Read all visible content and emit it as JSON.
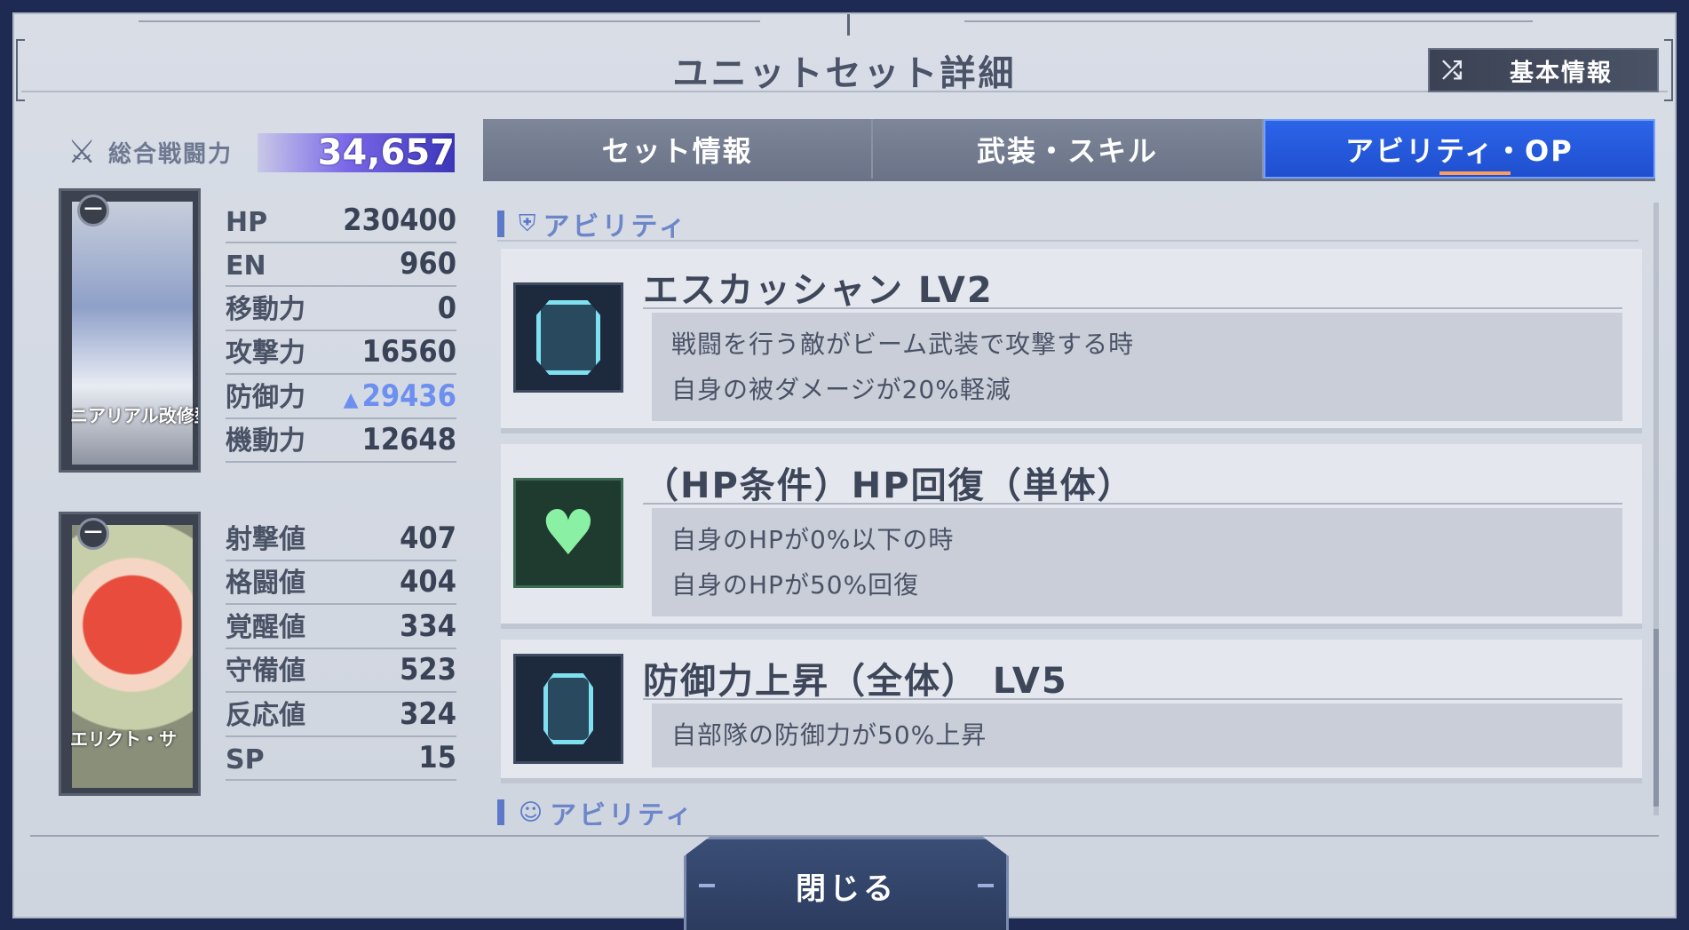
{
  "header": {
    "title": "ユニットセット詳細",
    "info_button_label": "基本情報"
  },
  "power": {
    "label": "総合戦闘力",
    "value": "34,657"
  },
  "unit": {
    "name": "ニアリアル改修型",
    "stats": [
      {
        "label": "HP",
        "value": "230400"
      },
      {
        "label": "EN",
        "value": "960"
      },
      {
        "label": "移動力",
        "value": "0"
      },
      {
        "label": "攻撃力",
        "value": "16560"
      },
      {
        "label": "防御力",
        "value": "29436",
        "buffed": true
      },
      {
        "label": "機動力",
        "value": "12648"
      }
    ]
  },
  "pilot": {
    "name": "エリクト・サ",
    "stats": [
      {
        "label": "射撃値",
        "value": "407"
      },
      {
        "label": "格闘値",
        "value": "404"
      },
      {
        "label": "覚醒値",
        "value": "334"
      },
      {
        "label": "守備値",
        "value": "523"
      },
      {
        "label": "反応値",
        "value": "324"
      },
      {
        "label": "SP",
        "value": "15"
      }
    ]
  },
  "tabs": [
    {
      "label": "セット情報",
      "active": false
    },
    {
      "label": "武装・スキル",
      "active": false
    },
    {
      "label": "アビリティ・OP",
      "active": true
    }
  ],
  "sections": [
    {
      "title": "アビリティ",
      "icon": "mech-icon",
      "abilities": [
        {
          "name": "エスカッシャン LV2",
          "icon": "shield-hex-icon",
          "lines": [
            "戦闘を行う敵がビーム武装で攻撃する時",
            "自身の被ダメージが20%軽減"
          ]
        },
        {
          "name": "（HP条件）HP回復（単体）",
          "icon": "heart-sparkle-icon",
          "lines": [
            "自身のHPが0%以下の時",
            "自身のHPが50%回復"
          ]
        },
        {
          "name": "防御力上昇（全体） LV5",
          "icon": "defense-icon",
          "lines": [
            "自部隊の防御力が50%上昇"
          ]
        }
      ]
    },
    {
      "title": "アビリティ",
      "icon": "pilot-icon"
    }
  ],
  "footer": {
    "close_label": "閉じる"
  },
  "colors": {
    "accent_blue": "#1f4fcf",
    "buff_blue": "#6c8ff0",
    "power_bar": "#7a68e8"
  }
}
